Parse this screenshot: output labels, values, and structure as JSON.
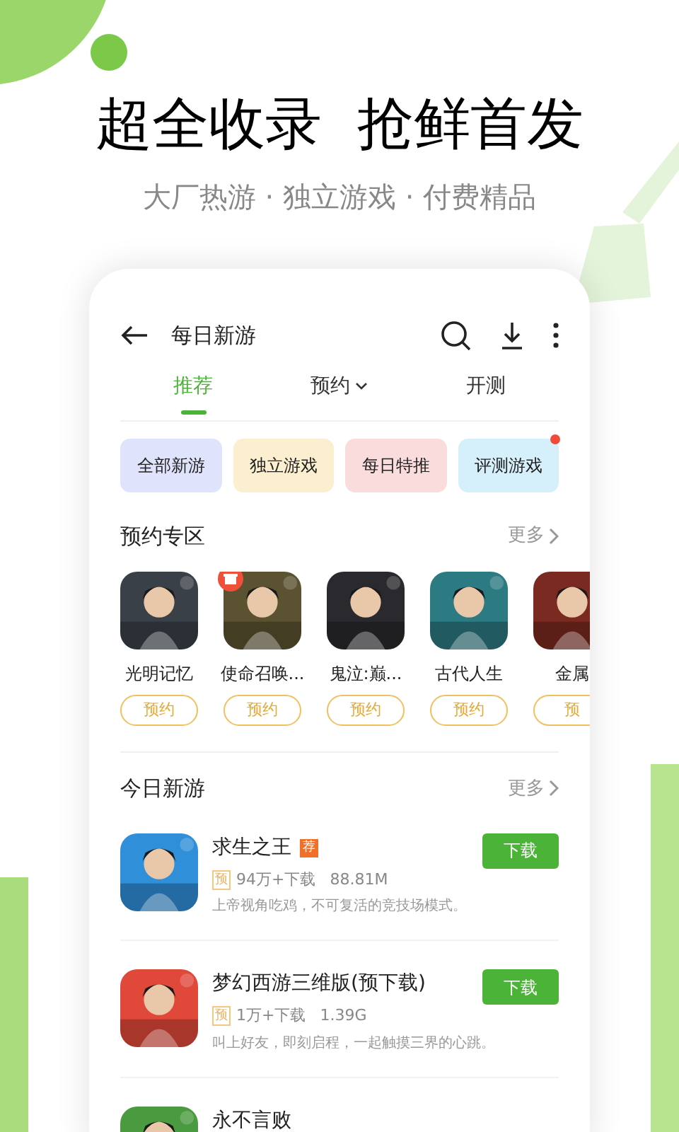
{
  "headline": "超全收录  抢鲜首发",
  "subtitle": "大厂热游 · 独立游戏 · 付费精品",
  "app": {
    "title": "每日新游",
    "tabs": [
      {
        "label": "推荐",
        "selected": true,
        "dropdown": false
      },
      {
        "label": "预约",
        "selected": false,
        "dropdown": true
      },
      {
        "label": "开测",
        "selected": false,
        "dropdown": false
      }
    ],
    "chips": [
      {
        "label": "全部新游",
        "color": "#dfe3fb",
        "dot": false
      },
      {
        "label": "独立游戏",
        "color": "#fcefd0",
        "dot": false
      },
      {
        "label": "每日特推",
        "color": "#fbdcdc",
        "dot": false
      },
      {
        "label": "评测游戏",
        "color": "#d6f0fb",
        "dot": true
      }
    ],
    "reserve": {
      "title": "预约专区",
      "more": "更多",
      "games": [
        {
          "name": "光明记忆",
          "button": "预约",
          "gift": false
        },
        {
          "name": "使命召唤...",
          "button": "预约",
          "gift": true
        },
        {
          "name": "鬼泣:巅...",
          "button": "预约",
          "gift": false
        },
        {
          "name": "古代人生",
          "button": "预约",
          "gift": false
        },
        {
          "name": "金属",
          "button": "预",
          "gift": false
        }
      ]
    },
    "today": {
      "title": "今日新游",
      "more": "更多",
      "games": [
        {
          "name": "求生之王",
          "tag": "荐",
          "pre": "预",
          "downloads": "94万+下载",
          "size": "88.81M",
          "desc": "上帝视角吃鸡，不可复活的竞技场模式。",
          "button": "下载"
        },
        {
          "name": "梦幻西游三维版(预下载)",
          "pre": "预",
          "downloads": "1万+下载",
          "size": "1.39G",
          "desc": "叫上好友，即刻启程，一起触摸三界的心跳。",
          "button": "下载"
        },
        {
          "name": "永不言败"
        }
      ]
    }
  }
}
